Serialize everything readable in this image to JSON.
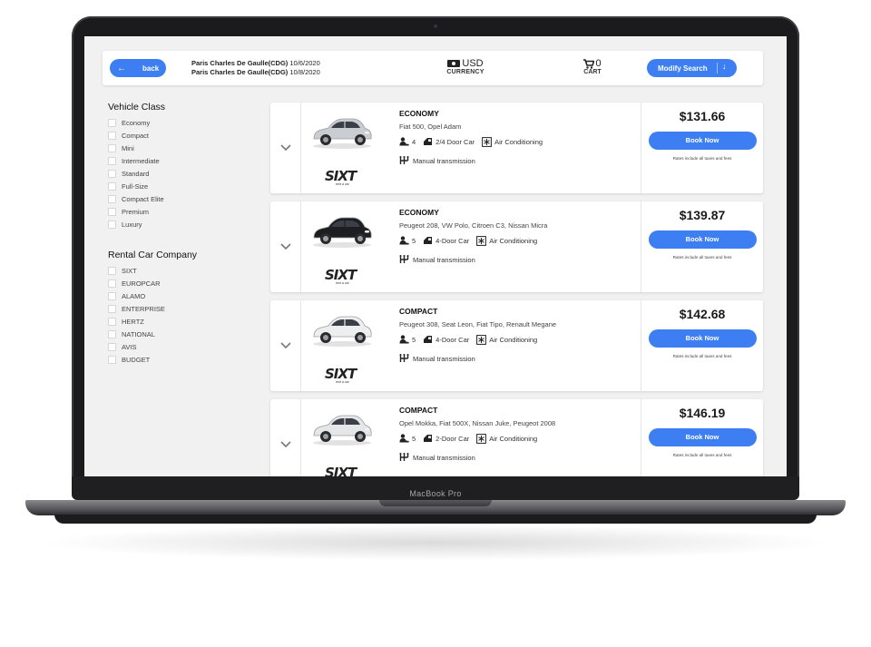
{
  "device": {
    "label": "MacBook Pro"
  },
  "header": {
    "back_label": "back",
    "route_line1_place": "Paris Charles De Gaulle(CDG)",
    "route_line1_date": "10/6/2020",
    "route_line2_place": "Paris Charles De Gaulle(CDG)",
    "route_line2_date": "10/8/2020",
    "currency_value": "USD",
    "currency_label": "CURRENCY",
    "cart_count": "0",
    "cart_label": "CART",
    "modify_label": "Modify Search"
  },
  "filters": {
    "vehicle_class_title": "Vehicle Class",
    "vehicle_classes": [
      "Economy",
      "Compact",
      "Mini",
      "Intermediate",
      "Standard",
      "Full-Size",
      "Compact Elite",
      "Premium",
      "Luxury"
    ],
    "company_title": "Rental Car Company",
    "companies": [
      "SIXT",
      "EUROPCAR",
      "ALAMO",
      "ENTERPRISE",
      "HERTZ",
      "NATIONAL",
      "AVIS",
      "BUDGET"
    ]
  },
  "results": [
    {
      "class": "ECONOMY",
      "models": "Fiat 500, Opel Adam",
      "seats": "4",
      "doors": "2/4 Door Car",
      "ac": "Air Conditioning",
      "transmission": "Manual transmission",
      "price": "$131.66",
      "book": "Book Now",
      "fine": "Rates include all taxes and fees",
      "vendor": "SIXT",
      "vendor_sub": "rent a car",
      "car_color": "#c9ccd0"
    },
    {
      "class": "ECONOMY",
      "models": "Peugeot 208, VW Polo, Citroen C3, Nissan Micra",
      "seats": "5",
      "doors": "4-Door Car",
      "ac": "Air Conditioning",
      "transmission": "Manual transmission",
      "price": "$139.87",
      "book": "Book Now",
      "fine": "Rates include all taxes and fees",
      "vendor": "SIXT",
      "vendor_sub": "rent a car",
      "car_color": "#1d1e22"
    },
    {
      "class": "COMPACT",
      "models": "Peugeot 308, Seat Leon, Fiat Tipo, Renault Megane",
      "seats": "5",
      "doors": "4-Door Car",
      "ac": "Air Conditioning",
      "transmission": "Manual transmission",
      "price": "$142.68",
      "book": "Book Now",
      "fine": "Rates include all taxes and fees",
      "vendor": "SIXT",
      "vendor_sub": "rent a car",
      "car_color": "#eceef0"
    },
    {
      "class": "COMPACT",
      "models": "Opel Mokka, Fiat 500X, Nissan Juke, Peugeot 2008",
      "seats": "5",
      "doors": "2-Door Car",
      "ac": "Air Conditioning",
      "transmission": "Manual transmission",
      "price": "$146.19",
      "book": "Book Now",
      "fine": "Rates include all taxes and fees",
      "vendor": "SIXT",
      "vendor_sub": "rent a car",
      "car_color": "#e4e6e8"
    }
  ],
  "colors": {
    "accent": "#3d7ff2",
    "screen_bg": "#f1f1f1",
    "laptop_body": "#1b1b1d"
  }
}
